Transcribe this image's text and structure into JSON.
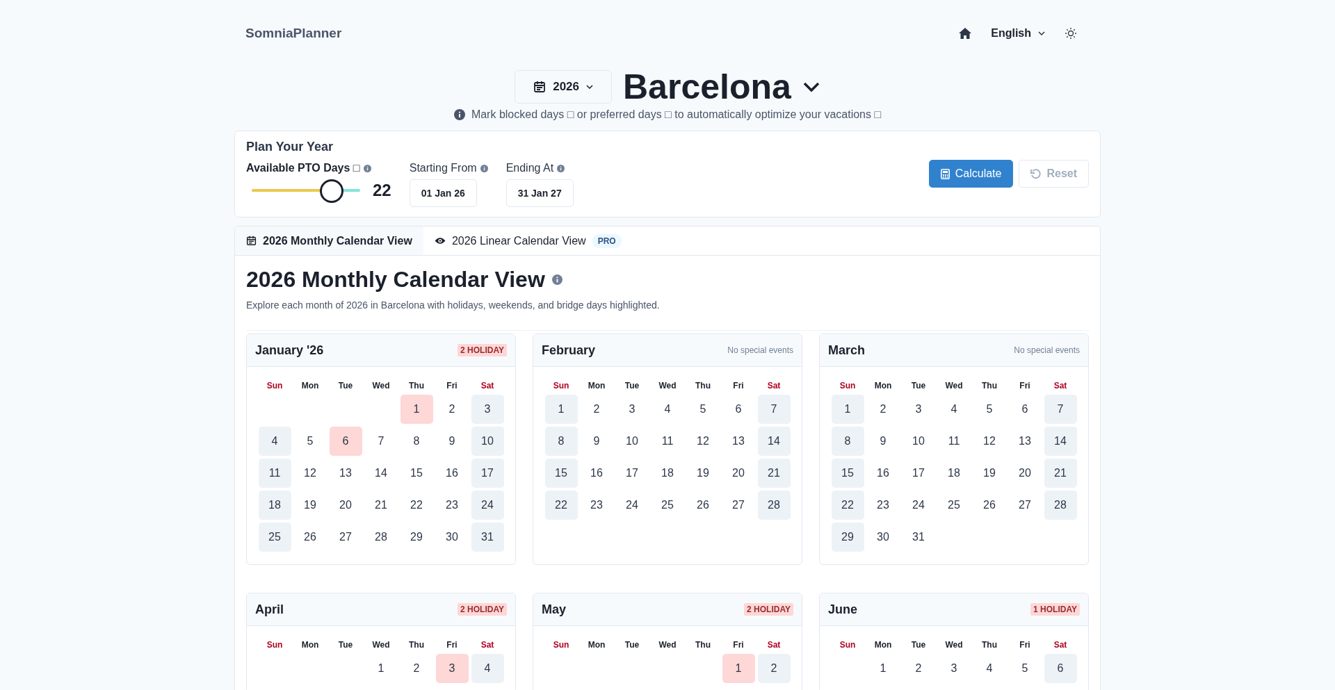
{
  "brand": "SomniaPlanner",
  "nav": {
    "language": "English"
  },
  "year_select": "2026",
  "city": "Barcelona",
  "hint": "Mark blocked days □ or preferred days □ to automatically optimize your vacations □",
  "plan": {
    "title": "Plan Your Year",
    "pto": {
      "label": "Available PTO Days □",
      "level": 0.72,
      "value": "22"
    },
    "start": {
      "label": "Starting From",
      "value": "01 Jan 26"
    },
    "end": {
      "label": "Ending At",
      "value": "31 Jan 27"
    },
    "buttons": [
      {
        "kind": "calculate",
        "label": "Calculate",
        "disabled": false
      },
      {
        "kind": "reset",
        "label": "Reset",
        "disabled": true
      }
    ]
  },
  "tabs": [
    {
      "kind": "calendar",
      "label": "2026 Monthly Calendar View",
      "selected": true
    },
    {
      "kind": "eye",
      "label": "2026 Linear Calendar View",
      "selected": false,
      "badge": "PRO"
    }
  ],
  "section": {
    "title": "2026 Monthly Calendar View",
    "description": "Explore each month of 2026 in Barcelona with holidays, weekends, and bridge days highlighted."
  },
  "months": [
    {
      "name": "January '26",
      "badge": "2 HOLIDAY",
      "weekdays": [
        "Sun",
        "Mon",
        "Tue",
        "Wed",
        "Thu",
        "Fri",
        "Sat"
      ],
      "weeks": [
        [
          {
            "d": "1",
            "kind": "holiday"
          },
          {
            "d": "2",
            "kind": "workday"
          },
          {
            "d": "3",
            "kind": "weekend"
          }
        ],
        [
          {
            "d": "4",
            "kind": "weekend"
          },
          {
            "d": "5",
            "kind": "workday"
          },
          {
            "d": "6",
            "kind": "holiday"
          },
          {
            "d": "7",
            "kind": "workday"
          },
          {
            "d": "8",
            "kind": "workday"
          },
          {
            "d": "9",
            "kind": "workday"
          },
          {
            "d": "10",
            "kind": "weekend"
          }
        ],
        [
          {
            "d": "11",
            "kind": "weekend"
          },
          {
            "d": "12",
            "kind": "workday"
          },
          {
            "d": "13",
            "kind": "workday"
          },
          {
            "d": "14",
            "kind": "workday"
          },
          {
            "d": "15",
            "kind": "workday"
          },
          {
            "d": "16",
            "kind": "workday"
          },
          {
            "d": "17",
            "kind": "weekend"
          }
        ],
        [
          {
            "d": "18",
            "kind": "weekend"
          },
          {
            "d": "19",
            "kind": "workday"
          },
          {
            "d": "20",
            "kind": "workday"
          },
          {
            "d": "21",
            "kind": "workday"
          },
          {
            "d": "22",
            "kind": "workday"
          },
          {
            "d": "23",
            "kind": "workday"
          },
          {
            "d": "24",
            "kind": "weekend"
          }
        ],
        [
          {
            "d": "25",
            "kind": "weekend"
          },
          {
            "d": "26",
            "kind": "workday"
          },
          {
            "d": "27",
            "kind": "workday"
          },
          {
            "d": "28",
            "kind": "workday"
          },
          {
            "d": "29",
            "kind": "workday"
          },
          {
            "d": "30",
            "kind": "workday"
          },
          {
            "d": "31",
            "kind": "weekend"
          }
        ]
      ]
    },
    {
      "name": "February",
      "note": "No special events",
      "weekdays": [
        "Sun",
        "Mon",
        "Tue",
        "Wed",
        "Thu",
        "Fri",
        "Sat"
      ],
      "weeks": [
        [
          {
            "d": "1",
            "kind": "weekend"
          },
          {
            "d": "2",
            "kind": "workday"
          },
          {
            "d": "3",
            "kind": "workday"
          },
          {
            "d": "4",
            "kind": "workday"
          },
          {
            "d": "5",
            "kind": "workday"
          },
          {
            "d": "6",
            "kind": "workday"
          },
          {
            "d": "7",
            "kind": "weekend"
          }
        ],
        [
          {
            "d": "8",
            "kind": "weekend"
          },
          {
            "d": "9",
            "kind": "workday"
          },
          {
            "d": "10",
            "kind": "workday"
          },
          {
            "d": "11",
            "kind": "workday"
          },
          {
            "d": "12",
            "kind": "workday"
          },
          {
            "d": "13",
            "kind": "workday"
          },
          {
            "d": "14",
            "kind": "weekend"
          }
        ],
        [
          {
            "d": "15",
            "kind": "weekend"
          },
          {
            "d": "16",
            "kind": "workday"
          },
          {
            "d": "17",
            "kind": "workday"
          },
          {
            "d": "18",
            "kind": "workday"
          },
          {
            "d": "19",
            "kind": "workday"
          },
          {
            "d": "20",
            "kind": "workday"
          },
          {
            "d": "21",
            "kind": "weekend"
          }
        ],
        [
          {
            "d": "22",
            "kind": "weekend"
          },
          {
            "d": "23",
            "kind": "workday"
          },
          {
            "d": "24",
            "kind": "workday"
          },
          {
            "d": "25",
            "kind": "workday"
          },
          {
            "d": "26",
            "kind": "workday"
          },
          {
            "d": "27",
            "kind": "workday"
          },
          {
            "d": "28",
            "kind": "weekend"
          }
        ]
      ]
    },
    {
      "name": "March",
      "note": "No special events",
      "weekdays": [
        "Sun",
        "Mon",
        "Tue",
        "Wed",
        "Thu",
        "Fri",
        "Sat"
      ],
      "weeks": [
        [
          {
            "d": "1",
            "kind": "weekend"
          },
          {
            "d": "2",
            "kind": "workday"
          },
          {
            "d": "3",
            "kind": "workday"
          },
          {
            "d": "4",
            "kind": "workday"
          },
          {
            "d": "5",
            "kind": "workday"
          },
          {
            "d": "6",
            "kind": "workday"
          },
          {
            "d": "7",
            "kind": "weekend"
          }
        ],
        [
          {
            "d": "8",
            "kind": "weekend"
          },
          {
            "d": "9",
            "kind": "workday"
          },
          {
            "d": "10",
            "kind": "workday"
          },
          {
            "d": "11",
            "kind": "workday"
          },
          {
            "d": "12",
            "kind": "workday"
          },
          {
            "d": "13",
            "kind": "workday"
          },
          {
            "d": "14",
            "kind": "weekend"
          }
        ],
        [
          {
            "d": "15",
            "kind": "weekend"
          },
          {
            "d": "16",
            "kind": "workday"
          },
          {
            "d": "17",
            "kind": "workday"
          },
          {
            "d": "18",
            "kind": "workday"
          },
          {
            "d": "19",
            "kind": "workday"
          },
          {
            "d": "20",
            "kind": "workday"
          },
          {
            "d": "21",
            "kind": "weekend"
          }
        ],
        [
          {
            "d": "22",
            "kind": "weekend"
          },
          {
            "d": "23",
            "kind": "workday"
          },
          {
            "d": "24",
            "kind": "workday"
          },
          {
            "d": "25",
            "kind": "workday"
          },
          {
            "d": "26",
            "kind": "workday"
          },
          {
            "d": "27",
            "kind": "workday"
          },
          {
            "d": "28",
            "kind": "weekend"
          }
        ],
        [
          {
            "d": "29",
            "kind": "weekend"
          },
          {
            "d": "30",
            "kind": "workday"
          },
          {
            "d": "31",
            "kind": "workday"
          }
        ]
      ]
    },
    {
      "name": "April",
      "badge": "2 HOLIDAY",
      "weekdays": [
        "Sun",
        "Mon",
        "Tue",
        "Wed",
        "Thu",
        "Fri",
        "Sat"
      ],
      "weeks": [
        [
          {
            "d": "1",
            "kind": "workday"
          },
          {
            "d": "2",
            "kind": "workday"
          },
          {
            "d": "3",
            "kind": "holiday"
          },
          {
            "d": "4",
            "kind": "weekend"
          }
        ]
      ]
    },
    {
      "name": "May",
      "badge": "2 HOLIDAY",
      "weekdays": [
        "Sun",
        "Mon",
        "Tue",
        "Wed",
        "Thu",
        "Fri",
        "Sat"
      ],
      "weeks": [
        [
          {
            "d": "1",
            "kind": "holiday"
          },
          {
            "d": "2",
            "kind": "weekend"
          }
        ]
      ]
    },
    {
      "name": "June",
      "badge": "1 HOLIDAY",
      "weekdays": [
        "Sun",
        "Mon",
        "Tue",
        "Wed",
        "Thu",
        "Fri",
        "Sat"
      ],
      "weeks": [
        [
          {
            "d": "1",
            "kind": "workday"
          },
          {
            "d": "2",
            "kind": "workday"
          },
          {
            "d": "3",
            "kind": "workday"
          },
          {
            "d": "4",
            "kind": "workday"
          },
          {
            "d": "5",
            "kind": "workday"
          },
          {
            "d": "6",
            "kind": "weekend"
          }
        ]
      ]
    }
  ]
}
